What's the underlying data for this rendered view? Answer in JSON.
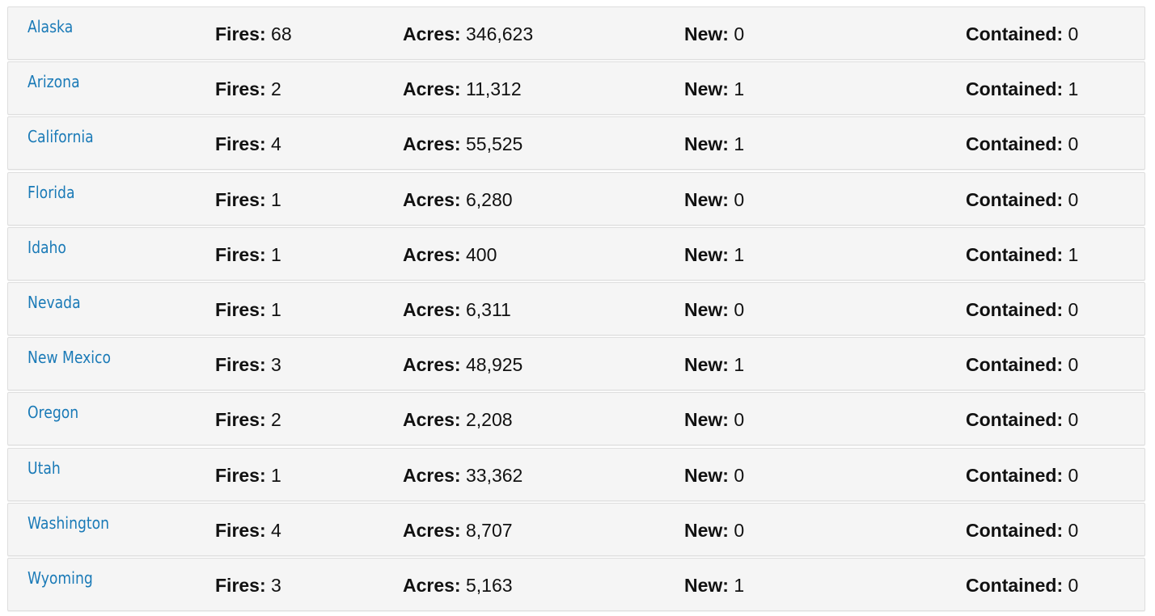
{
  "labels": {
    "fires": "Fires:",
    "acres": "Acres:",
    "new": "New:",
    "contained": "Contained:"
  },
  "states": [
    {
      "name": "Alaska",
      "fires": "68",
      "acres": "346,623",
      "new": "0",
      "contained": "0"
    },
    {
      "name": "Arizona",
      "fires": "2",
      "acres": "11,312",
      "new": "1",
      "contained": "1"
    },
    {
      "name": "California",
      "fires": "4",
      "acres": "55,525",
      "new": "1",
      "contained": "0"
    },
    {
      "name": "Florida",
      "fires": "1",
      "acres": "6,280",
      "new": "0",
      "contained": "0"
    },
    {
      "name": "Idaho",
      "fires": "1",
      "acres": "400",
      "new": "1",
      "contained": "1"
    },
    {
      "name": "Nevada",
      "fires": "1",
      "acres": "6,311",
      "new": "0",
      "contained": "0"
    },
    {
      "name": "New Mexico",
      "fires": "3",
      "acres": "48,925",
      "new": "1",
      "contained": "0"
    },
    {
      "name": "Oregon",
      "fires": "2",
      "acres": "2,208",
      "new": "0",
      "contained": "0"
    },
    {
      "name": "Utah",
      "fires": "1",
      "acres": "33,362",
      "new": "0",
      "contained": "0"
    },
    {
      "name": "Washington",
      "fires": "4",
      "acres": "8,707",
      "new": "0",
      "contained": "0"
    },
    {
      "name": "Wyoming",
      "fires": "3",
      "acres": "5,163",
      "new": "1",
      "contained": "0"
    }
  ]
}
